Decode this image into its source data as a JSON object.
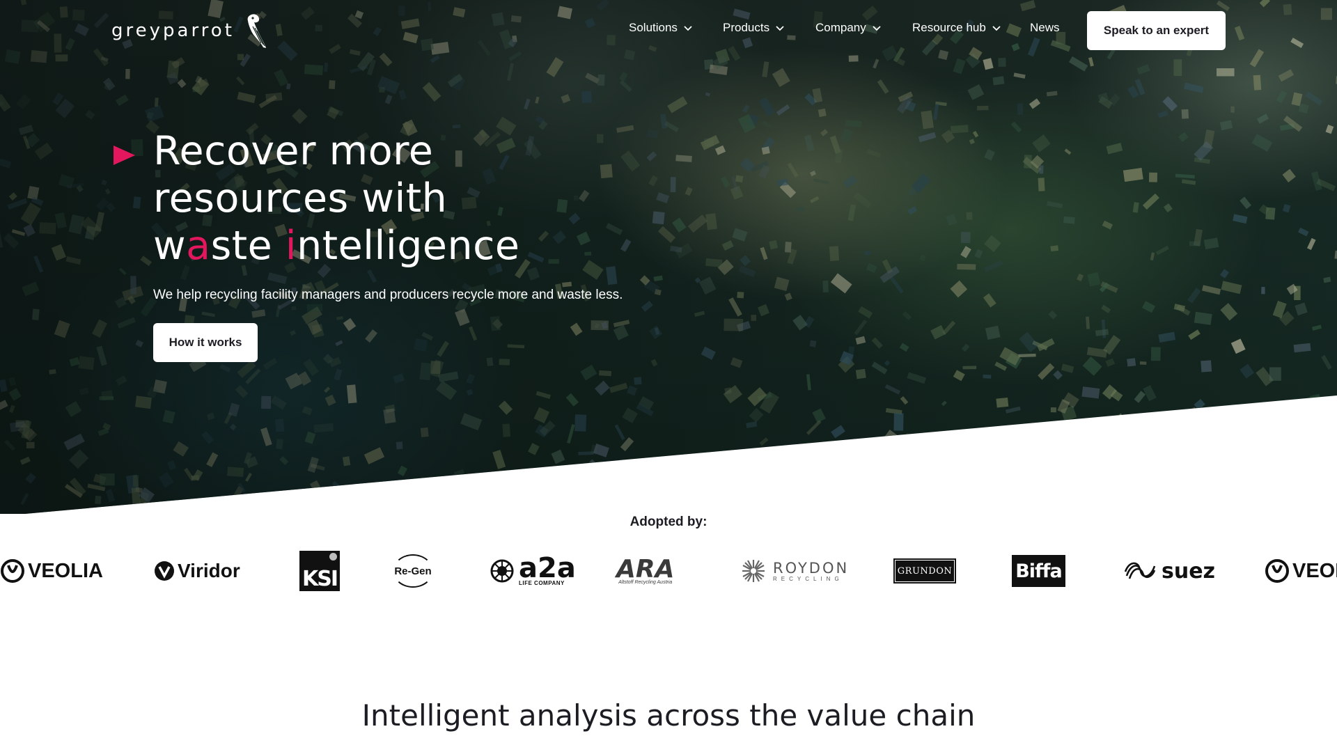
{
  "brand": {
    "name": "greyparrot"
  },
  "nav": {
    "items": [
      {
        "label": "Solutions",
        "has_dropdown": true
      },
      {
        "label": "Products",
        "has_dropdown": true
      },
      {
        "label": "Company",
        "has_dropdown": true
      },
      {
        "label": "Resource hub",
        "has_dropdown": true
      },
      {
        "label": "News",
        "has_dropdown": false
      }
    ],
    "cta_label": "Speak to an expert"
  },
  "hero": {
    "headline_line1": "Recover more",
    "headline_line2": "resources with",
    "headline_line3_parts": [
      "w",
      "a",
      "ste ",
      "i",
      "ntelligence"
    ],
    "subcopy": "We help recycling facility managers and producers recycle more and waste less.",
    "cta_label": "How it works",
    "accent_color": "#e3175e"
  },
  "adopted": {
    "label": "Adopted by:",
    "logos": [
      {
        "name": "VEOLIA",
        "icon": "veolia-logo"
      },
      {
        "name": "Viridor",
        "icon": "viridor-logo"
      },
      {
        "name": "KSI",
        "icon": "ksi-logo"
      },
      {
        "name": "Re-Gen",
        "icon": "regen-logo"
      },
      {
        "name": "a2a",
        "sub": "LIFE COMPANY",
        "icon": "a2a-logo"
      },
      {
        "name": "ARA",
        "sub": "Altstoff Recycling Austria",
        "icon": "ara-logo"
      },
      {
        "name": "ROYDON",
        "sub": "RECYCLING",
        "icon": "roydon-logo"
      },
      {
        "name": "GRUNDON",
        "icon": "grundon-logo"
      },
      {
        "name": "Biffa",
        "icon": "biffa-logo"
      },
      {
        "name": "suez",
        "icon": "suez-logo"
      },
      {
        "name": "VEOLIA",
        "icon": "veolia-logo"
      }
    ]
  },
  "section": {
    "title": "Intelligent analysis across the value chain"
  }
}
